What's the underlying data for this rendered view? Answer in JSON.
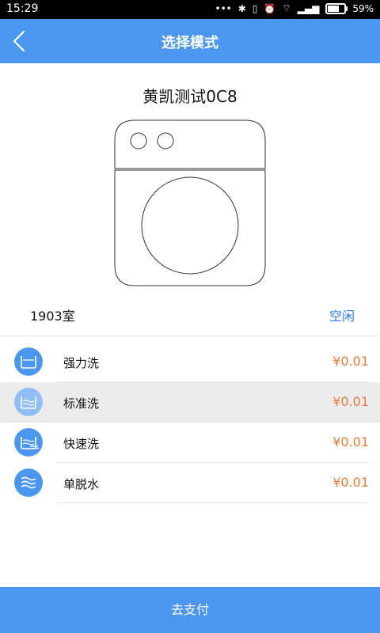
{
  "status_bar": {
    "time": "15:29",
    "battery": "59%"
  },
  "appbar": {
    "title": "选择模式",
    "back_icon": "back-chevron-icon"
  },
  "device": {
    "name": "黄凯测试0C8",
    "room": "1903室",
    "status": "空闲"
  },
  "modes": [
    {
      "label": "强力洗",
      "price": "¥0.01",
      "icon": "basin-icon",
      "selected": false
    },
    {
      "label": "标准洗",
      "price": "¥0.01",
      "icon": "basin-waves-icon",
      "selected": true
    },
    {
      "label": "快速洗",
      "price": "¥0.01",
      "icon": "fast-wash-icon",
      "selected": false
    },
    {
      "label": "单脱水",
      "price": "¥0.01",
      "icon": "spin-waves-icon",
      "selected": false
    }
  ],
  "pay_button": {
    "label": "去支付"
  },
  "colors": {
    "primary": "#4b97ef",
    "price": "#ee7a3a",
    "status_text": "#2f7ee6",
    "selected_row": "#ececec"
  }
}
